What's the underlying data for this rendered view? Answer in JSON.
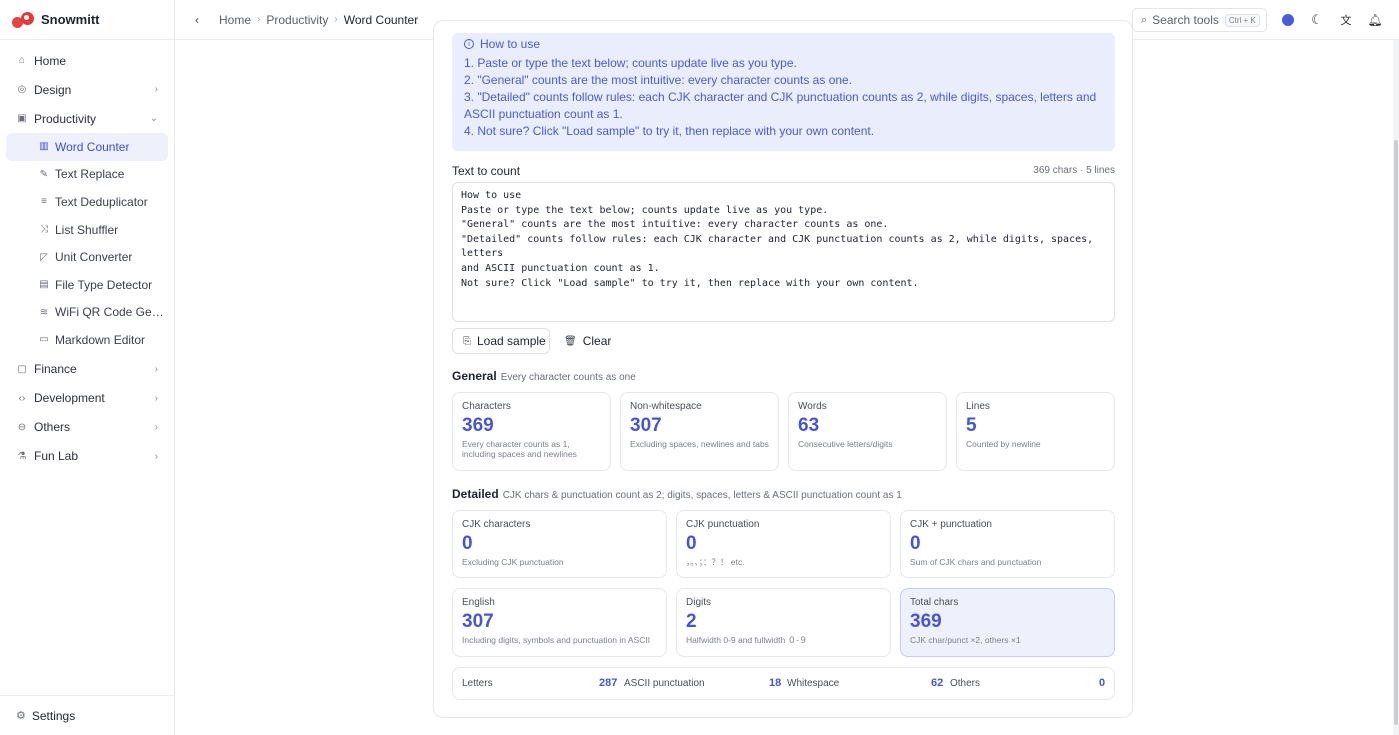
{
  "app": {
    "title": "Snowmitt"
  },
  "sidebar": {
    "items": [
      {
        "label": "Home",
        "icon": "home-icon"
      },
      {
        "label": "Design",
        "icon": "palette-icon"
      },
      {
        "label": "Productivity",
        "icon": "briefcase-icon"
      }
    ],
    "productivity_children": [
      {
        "label": "Word Counter",
        "icon": "chart-icon"
      },
      {
        "label": "Text Replace",
        "icon": "pencil-icon"
      },
      {
        "label": "Text Deduplicator",
        "icon": "filter-icon"
      },
      {
        "label": "List Shuffler",
        "icon": "shuffle-icon"
      },
      {
        "label": "Unit Converter",
        "icon": "ruler-icon"
      },
      {
        "label": "File Type Detector",
        "icon": "file-icon"
      },
      {
        "label": "WiFi QR Code Gener...",
        "icon": "wifi-icon"
      },
      {
        "label": "Markdown Editor",
        "icon": "markdown-icon"
      }
    ],
    "more_items": [
      {
        "label": "Finance",
        "icon": "wallet-icon"
      },
      {
        "label": "Development",
        "icon": "code-icon"
      },
      {
        "label": "Others",
        "icon": "dots-circle-icon"
      },
      {
        "label": "Fun Lab",
        "icon": "flask-icon"
      }
    ],
    "settings_label": "Settings"
  },
  "breadcrumb": {
    "home": "Home",
    "section": "Productivity",
    "current": "Word Counter"
  },
  "search": {
    "placeholder": "Search tools",
    "shortcut": "Ctrl + K"
  },
  "howto": {
    "title": "How to use",
    "lines": [
      "1. Paste or type the text below; counts update live as you type.",
      "2. \"General\" counts are the most intuitive: every character counts as one.",
      "3. \"Detailed\" counts follow rules: each CJK character and CJK punctuation counts as 2, while digits, spaces, letters and ASCII punctuation count as 1.",
      "4. Not sure? Click \"Load sample\" to try it, then replace with your own content."
    ]
  },
  "input": {
    "label": "Text to count",
    "meta": "369 chars · 5 lines",
    "value": "How to use\nPaste or type the text below; counts update live as you type.\n\"General\" counts are the most intuitive: every character counts as one.\n\"Detailed\" counts follow rules: each CJK character and CJK punctuation counts as 2, while digits, spaces, letters\nand ASCII punctuation count as 1.\nNot sure? Click \"Load sample\" to try it, then replace with your own content."
  },
  "buttons": {
    "load_sample": "Load sample",
    "clear": "Clear"
  },
  "general": {
    "title": "General",
    "desc": "Every character counts as one",
    "stats": [
      {
        "label": "Characters",
        "value": "369",
        "hint": "Every character counts as 1, including spaces and newlines"
      },
      {
        "label": "Non-whitespace",
        "value": "307",
        "hint": "Excluding spaces, newlines and tabs"
      },
      {
        "label": "Words",
        "value": "63",
        "hint": "Consecutive letters/digits"
      },
      {
        "label": "Lines",
        "value": "5",
        "hint": "Counted by newline"
      }
    ]
  },
  "detailed": {
    "title": "Detailed",
    "desc": "CJK chars & punctuation count as 2; digits, spaces, letters & ASCII punctuation count as 1",
    "stats": [
      {
        "label": "CJK characters",
        "value": "0",
        "hint": "Excluding CJK punctuation"
      },
      {
        "label": "CJK punctuation",
        "value": "0",
        "hint": "，。、；：？！ etc."
      },
      {
        "label": "CJK + punctuation",
        "value": "0",
        "hint": "Sum of CJK chars and punctuation"
      },
      {
        "label": "English",
        "value": "307",
        "hint": "Including digits, symbols and punctuation in ASCII"
      },
      {
        "label": "Digits",
        "value": "2",
        "hint": "Halfwidth 0-9 and fullwidth ０-９"
      },
      {
        "label": "Total chars",
        "value": "369",
        "hint": "CJK char/punct ×2, others ×1"
      }
    ],
    "breakdown": [
      {
        "label": "Letters",
        "value": "287"
      },
      {
        "label": "ASCII punctuation",
        "value": "18"
      },
      {
        "label": "Whitespace",
        "value": "62"
      },
      {
        "label": "Others",
        "value": "0"
      }
    ]
  },
  "colors": {
    "accent": "#4656d3",
    "accent_bg": "#eaedfc"
  }
}
